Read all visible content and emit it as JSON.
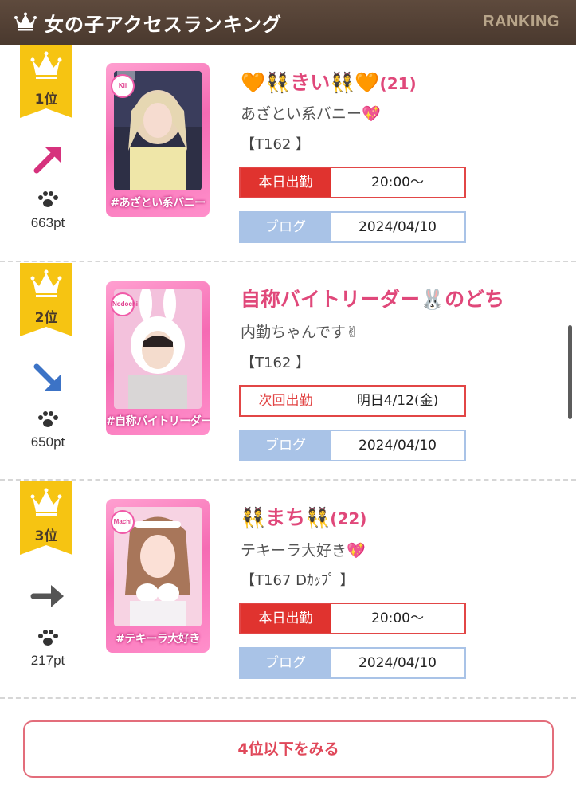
{
  "header": {
    "title": "女の子アクセスランキング",
    "tag": "RANKING"
  },
  "ranking": [
    {
      "rank_label": "1位",
      "trend": "up-right-arrow",
      "points": "663pt",
      "card_caption": "#あざとい系バニー",
      "card_tag": "Kii",
      "name_prefix": "🧡👯",
      "name_text": "きい",
      "name_suffix": "👯🧡",
      "age": "(21)",
      "catchphrase": "あざとい系バニー💖",
      "size": "【T162 】",
      "shift_label": "本日出勤",
      "shift_value": "20:00〜",
      "shift_type": "today",
      "blog_label": "ブログ",
      "blog_date": "2024/04/10"
    },
    {
      "rank_label": "2位",
      "trend": "down-right-arrow",
      "points": "650pt",
      "card_caption": "#自称バイトリーダー",
      "card_tag": "Nodochi",
      "name_prefix": "",
      "name_text": "自称バイトリーダー",
      "name_suffix": "🐰のどち",
      "age": "",
      "catchphrase": "内勤ちゃんです✌",
      "size": "【T162 】",
      "shift_label": "次回出勤",
      "shift_value": "明日4/12(金)",
      "shift_type": "next",
      "blog_label": "ブログ",
      "blog_date": "2024/04/10"
    },
    {
      "rank_label": "3位",
      "trend": "right-arrow",
      "points": "217pt",
      "card_caption": "#テキーラ大好き",
      "card_tag": "Machi",
      "name_prefix": "👯",
      "name_text": "まち",
      "name_suffix": "👯",
      "age": "(22)",
      "catchphrase": "テキーラ大好き💖",
      "size": "【T167 Dｶｯﾌﾟ 】",
      "shift_label": "本日出勤",
      "shift_value": "20:00〜",
      "shift_type": "today",
      "blog_label": "ブログ",
      "blog_date": "2024/04/10"
    }
  ],
  "more_button": "4位以下をみる",
  "colors": {
    "header_bg": "#4a392e",
    "accent_pink": "#e0487a",
    "today_red": "#e0332f",
    "blog_blue": "#a9c3e7",
    "badge_gold": "#f6c412"
  }
}
